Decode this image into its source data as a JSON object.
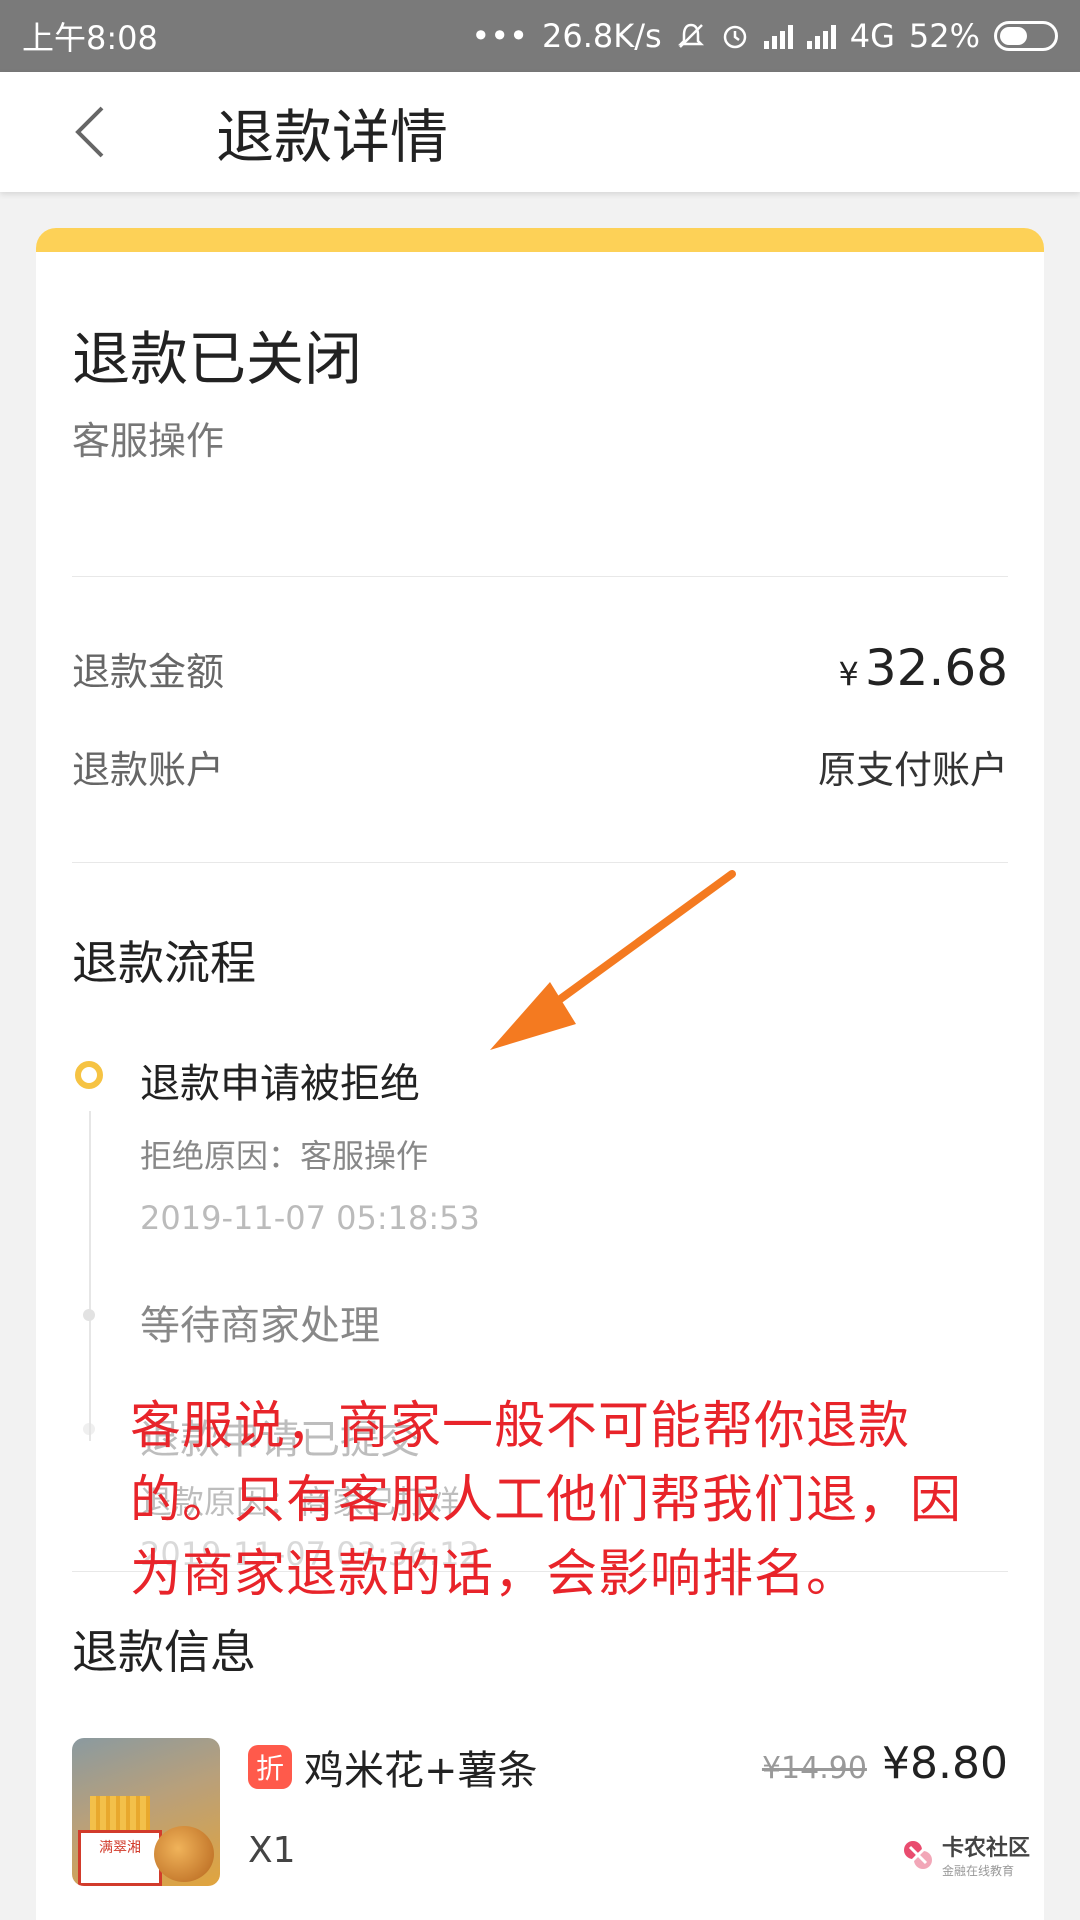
{
  "status_bar": {
    "time": "上午8:08",
    "speed": "26.8K/s",
    "network": "4G",
    "battery": "52%"
  },
  "header": {
    "title": "退款详情"
  },
  "status": {
    "title": "退款已关闭",
    "subtitle": "客服操作"
  },
  "refund": {
    "amount_label": "退款金额",
    "currency": "¥",
    "amount": "32.68",
    "account_label": "退款账户",
    "account_value": "原支付账户"
  },
  "process": {
    "title": "退款流程",
    "steps": [
      {
        "title": "退款申请被拒绝",
        "reason": "拒绝原因：客服操作",
        "time": "2019-11-07 05:18:53"
      },
      {
        "title": "等待商家处理"
      },
      {
        "title": "退款申请已提交",
        "reason": "退款原因：商家已打烊",
        "time": "2019-11-07 03:36:12"
      }
    ]
  },
  "info": {
    "title": "退款信息",
    "product": {
      "badge": "折",
      "name": "鸡米花+薯条",
      "qty": "X1",
      "old_price": "¥14.90",
      "new_price": "¥8.80",
      "thumb_label": "满翠湘"
    }
  },
  "annotation": {
    "text": "客服说，商家一般不可能帮你退款的。只有客服人工他们帮我们退，因为商家退款的话，会影响排名。"
  },
  "watermark": {
    "title": "卡农社区",
    "subtitle": "金融在线教育"
  },
  "colors": {
    "accent_yellow": "#fdd157",
    "annotation_red": "#e8242a",
    "arrow_orange": "#f47a20",
    "badge_red": "#ff5a4b"
  }
}
